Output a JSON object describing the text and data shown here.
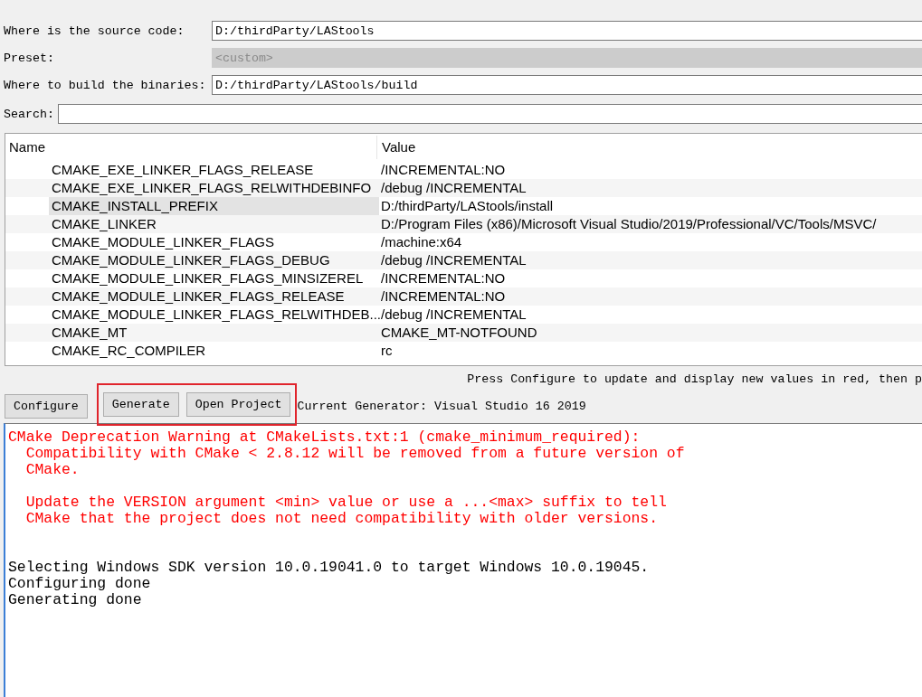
{
  "form": [
    {
      "label": "Where is the source code:",
      "value": "D:/thirdParty/LAStools",
      "disabled": false
    },
    {
      "label": "Preset:",
      "value": "<custom>",
      "disabled": true
    },
    {
      "label": "Where to build the binaries:",
      "value": "D:/thirdParty/LAStools/build",
      "disabled": false
    }
  ],
  "search": {
    "label": "Search:"
  },
  "table": {
    "columns": [
      "Name",
      "Value"
    ],
    "rows": [
      {
        "name": "CMAKE_EXE_LINKER_FLAGS_RELEASE",
        "value": "/INCREMENTAL:NO",
        "selected": false
      },
      {
        "name": "CMAKE_EXE_LINKER_FLAGS_RELWITHDEBINFO",
        "value": "/debug /INCREMENTAL",
        "selected": false
      },
      {
        "name": "CMAKE_INSTALL_PREFIX",
        "value": "D:/thirdParty/LAStools/install",
        "selected": true
      },
      {
        "name": "CMAKE_LINKER",
        "value": "D:/Program Files (x86)/Microsoft Visual Studio/2019/Professional/VC/Tools/MSVC/",
        "selected": false
      },
      {
        "name": "CMAKE_MODULE_LINKER_FLAGS",
        "value": "/machine:x64",
        "selected": false
      },
      {
        "name": "CMAKE_MODULE_LINKER_FLAGS_DEBUG",
        "value": "/debug /INCREMENTAL",
        "selected": false
      },
      {
        "name": "CMAKE_MODULE_LINKER_FLAGS_MINSIZEREL",
        "value": "/INCREMENTAL:NO",
        "selected": false
      },
      {
        "name": "CMAKE_MODULE_LINKER_FLAGS_RELEASE",
        "value": "/INCREMENTAL:NO",
        "selected": false
      },
      {
        "name": "CMAKE_MODULE_LINKER_FLAGS_RELWITHDEB...",
        "value": "/debug /INCREMENTAL",
        "selected": false
      },
      {
        "name": "CMAKE_MT",
        "value": "CMAKE_MT-NOTFOUND",
        "selected": false
      },
      {
        "name": "CMAKE_RC_COMPILER",
        "value": "rc",
        "selected": false
      }
    ]
  },
  "hint": "Press Configure to update and display new values in red, then p",
  "buttons": [
    {
      "label": "Configure",
      "highlighted": false
    },
    {
      "label": "Generate",
      "highlighted": true
    },
    {
      "label": "Open Project",
      "highlighted": true
    }
  ],
  "generator": "Current Generator: Visual Studio 16 2019",
  "log": [
    {
      "kind": "warning",
      "text": "CMake Deprecation Warning at CMakeLists.txt:1 (cmake_minimum_required):"
    },
    {
      "kind": "warning",
      "text": "  Compatibility with CMake < 2.8.12 will be removed from a future version of"
    },
    {
      "kind": "warning",
      "text": "  CMake."
    },
    {
      "kind": "blank"
    },
    {
      "kind": "warning",
      "text": "  Update the VERSION argument <min> value or use a ...<max> suffix to tell"
    },
    {
      "kind": "warning",
      "text": "  CMake that the project does not need compatibility with older versions."
    },
    {
      "kind": "blank"
    },
    {
      "kind": "blank"
    },
    {
      "kind": "normal",
      "text": "Selecting Windows SDK version 10.0.19041.0 to target Windows 10.0.19045."
    },
    {
      "kind": "normal",
      "text": "Configuring done"
    },
    {
      "kind": "normal",
      "text": "Generating done"
    }
  ]
}
